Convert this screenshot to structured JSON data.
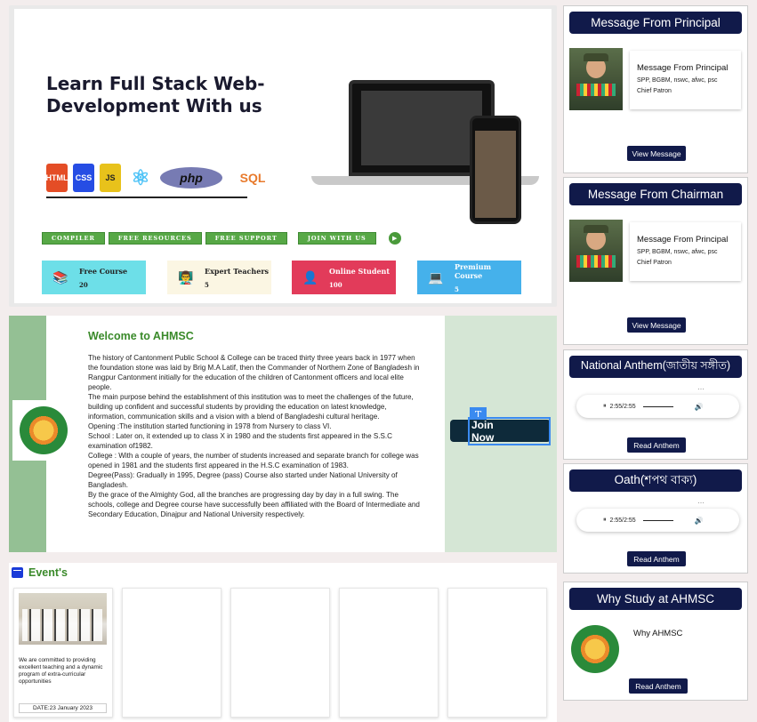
{
  "hero": {
    "title": "Learn Full Stack Web-Development With us",
    "tech": [
      "HTML",
      "CSS",
      "JS",
      "php",
      "SQL"
    ],
    "buttons": [
      "COMPILER",
      "FREE RESOURCES",
      "FREE SUPPORT",
      "JOIN WITH US"
    ],
    "stats": [
      {
        "label": "Free Course",
        "value": "20"
      },
      {
        "label": "Expert Teachers",
        "value": "5"
      },
      {
        "label": "Online Student",
        "value": "100"
      },
      {
        "label": "Premium Course",
        "value": "5"
      }
    ]
  },
  "welcome": {
    "title": "Welcome to AHMSC",
    "paragraphs": [
      "The history of Cantonment Public School & College can be traced thirty three years back in 1977 when the foundation stone was laid by Brig M.A Latif, then the Commander of Northern Zone of Bangladesh in Rangpur Cantonment initially for the education of the children of Cantonment officers and local elite people.",
      "The main purpose behind the establishment of this institution was to meet the challenges of the future, building up confident and successful students by providing the education on latest knowledge, information, communication skills and a vision with a blend of Bangladeshi cultural heritage.",
      "Opening :The institution started functioning in 1978 from Nursery to class VI.",
      "School : Later on, it extended up to class X in 1980 and the students first appeared in the S.S.C examination of1982.",
      "College : With a couple of years, the number of students increased and separate branch for college was opened in 1981 and the students first appeared in the H.S.C examination of 1983.",
      "Degree(Pass): Gradually in 1995, Degree (pass) Course also started under National University of Bangladesh.",
      "By the grace of the Almighty God, all the branches are progressing day by day in a full swing. The schools, college and Degree course have successfully been affiliated with the Board of Intermediate and Secondary Education, Dinajpur and National University respectively."
    ],
    "t_icon": "T",
    "join_label": "Join Now"
  },
  "events": {
    "title": "Event's",
    "cards": [
      {
        "text": "We are committed to providing excellent teaching and a dynamic program of extra-curricular opportunities",
        "date": "DATE:23 January 2023"
      }
    ]
  },
  "sidebar": {
    "principal": {
      "heading": "Message From Principal",
      "name": "Message From Principal",
      "degrees": "SPP, BGBM, nswc, afwc, psc",
      "role": "Chief Patron",
      "button": "View Message"
    },
    "chairman": {
      "heading": "Message From Chairman",
      "name": "Message From Principal",
      "degrees": "SPP, BGBM, nswc, afwc, psc",
      "role": "Chief Patron",
      "button": "View Message"
    },
    "anthem": {
      "heading": "National Anthem(জাতীয় সঙ্গীত)",
      "time": "2:55/2:55",
      "button": "Read Anthem"
    },
    "oath": {
      "heading": "Oath(শপথ বাক্য)",
      "time": "2:55/2:55",
      "button": "Read Anthem"
    },
    "why": {
      "heading": "Why Study at AHMSC",
      "text": "Why AHMSC",
      "button": "Read Anthem"
    }
  }
}
